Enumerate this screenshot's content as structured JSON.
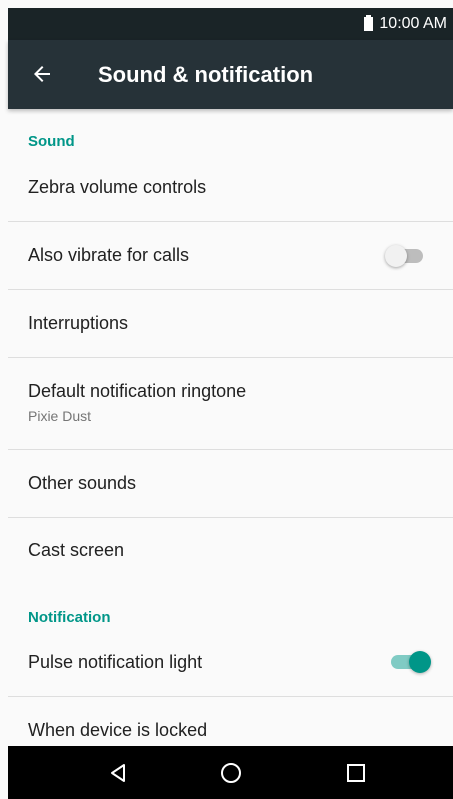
{
  "status_bar": {
    "time": "10:00 AM",
    "battery_icon": "battery-full-icon"
  },
  "app_bar": {
    "back_icon": "arrow-back-icon",
    "title": "Sound & notification"
  },
  "sections": [
    {
      "header": "Sound",
      "items": [
        {
          "title": "Zebra volume controls"
        },
        {
          "title": "Also vibrate for calls",
          "toggle": false
        },
        {
          "title": "Interruptions"
        },
        {
          "title": "Default notification ringtone",
          "summary": "Pixie Dust"
        },
        {
          "title": "Other sounds"
        },
        {
          "title": "Cast screen"
        }
      ]
    },
    {
      "header": "Notification",
      "items": [
        {
          "title": "Pulse notification light",
          "toggle": true
        },
        {
          "title": "When device is locked"
        }
      ]
    }
  ],
  "nav_bar": {
    "back_icon": "nav-back-triangle-icon",
    "home_icon": "nav-home-circle-icon",
    "recents_icon": "nav-recents-square-icon"
  },
  "colors": {
    "status_bar": "#1a2427",
    "app_bar": "#263238",
    "accent": "#009688",
    "background": "#fafafa"
  }
}
